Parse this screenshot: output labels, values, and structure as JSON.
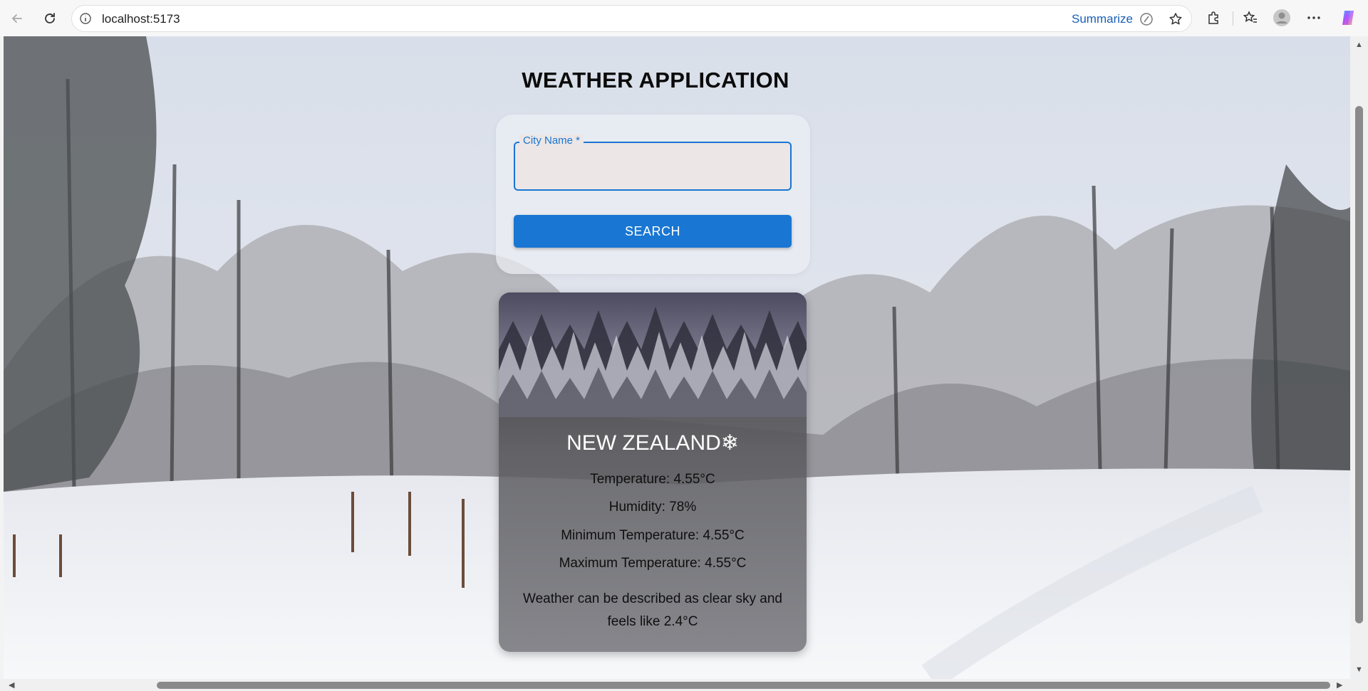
{
  "browser": {
    "url": "localhost:5173",
    "summarize_label": "Summarize"
  },
  "app": {
    "title": "WEATHER APPLICATION",
    "city_field_label": "City Name *",
    "city_field_value": "",
    "search_label": "SEARCH"
  },
  "result": {
    "city": "NEW ZEALAND❄",
    "temperature": "Temperature: 4.55°C",
    "humidity": "Humidity: 78%",
    "min_temp": "Minimum Temperature: 4.55°C",
    "max_temp": "Maximum Temperature: 4.55°C",
    "description": "Weather can be described as clear sky and feels like 2.4°C"
  },
  "colors": {
    "accent": "#1976d2",
    "title": "#0b0b0b"
  }
}
